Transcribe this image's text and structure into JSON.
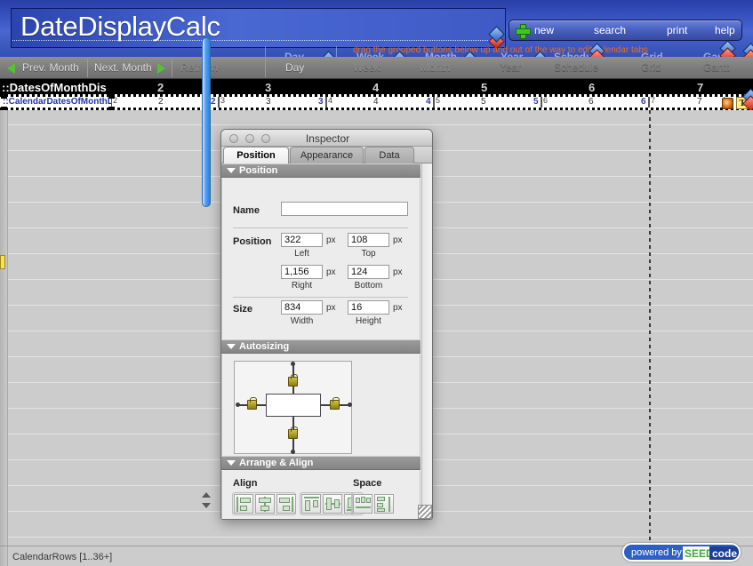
{
  "window": {
    "title_field_value": "DateDisplayCalc",
    "drag_hint": "drag the grouped buttons below up and out of the way to edit calendar tabs"
  },
  "toolbar": {
    "new_label": "new",
    "search_label": "search",
    "print_label": "print",
    "help_label": "help"
  },
  "navbar": {
    "prev_month": "Prev. Month",
    "next_month": "Next. Month",
    "refresh": "Refresh",
    "tabs": [
      "Day",
      "Week",
      "Month",
      "Year",
      "Schedule",
      "Grid",
      "Gantt"
    ]
  },
  "header_row": {
    "field_name": "::DatesOfMonthDis",
    "numbers": [
      "2",
      "3",
      "4",
      "5",
      "6",
      "7"
    ]
  },
  "selected_row": {
    "jumbled_field": "::CalendarDatesOfMonthDisplayCalc",
    "cells": [
      {
        "small": "2",
        "mid": "2",
        "bold": "2"
      },
      {
        "small": "3",
        "mid": "3",
        "bold": "3"
      },
      {
        "small": "4",
        "mid": "4",
        "bold": "4"
      },
      {
        "small": "5",
        "mid": "5",
        "bold": "5"
      },
      {
        "small": "6",
        "mid": "6",
        "bold": "6"
      },
      {
        "small": "7",
        "mid": "7",
        "bold": ""
      }
    ],
    "text_tool_glyph": "T"
  },
  "status": {
    "part_label": "CalendarRows [1..36+]"
  },
  "badge": {
    "powered_by": "powered by",
    "seed": "SEED",
    "code": "code"
  },
  "inspector": {
    "title": "Inspector",
    "tabs": [
      {
        "label": "Position",
        "active": true
      },
      {
        "label": "Appearance",
        "active": false
      },
      {
        "label": "Data",
        "active": false
      }
    ],
    "position_section": {
      "header": "Position",
      "name_label": "Name",
      "name_value": "",
      "position_label": "Position",
      "left_value": "322",
      "left_caption": "Left",
      "top_value": "108",
      "top_caption": "Top",
      "right_value": "1,156",
      "right_caption": "Right",
      "bottom_value": "124",
      "bottom_caption": "Bottom",
      "size_label": "Size",
      "width_value": "834",
      "width_caption": "Width",
      "height_value": "16",
      "height_caption": "Height",
      "unit": "px"
    },
    "autosizing_section": {
      "header": "Autosizing"
    },
    "arrange_section": {
      "header": "Arrange & Align",
      "align_label": "Align",
      "space_label": "Space"
    }
  },
  "colors": {
    "header_blue": "#3b57c4",
    "hint_orange": "#e86a20",
    "accent_green": "#52c22e",
    "scroll_blue": "#4d9cf0",
    "lock_gold": "#8c7c15"
  }
}
